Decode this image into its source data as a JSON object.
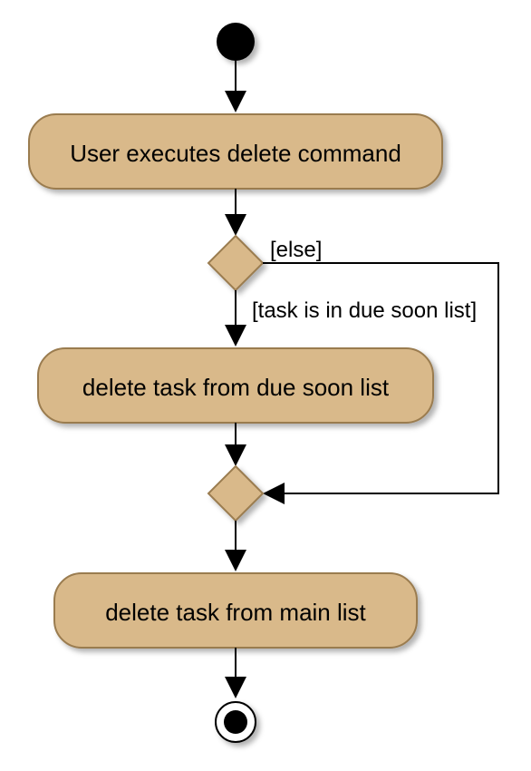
{
  "chart_data": {
    "type": "activity_diagram",
    "title": "",
    "nodes": [
      {
        "id": "start",
        "type": "initial"
      },
      {
        "id": "n1",
        "type": "activity",
        "label": "User executes delete command"
      },
      {
        "id": "d1",
        "type": "decision"
      },
      {
        "id": "n2",
        "type": "activity",
        "label": "delete task from due soon list"
      },
      {
        "id": "m1",
        "type": "merge"
      },
      {
        "id": "n3",
        "type": "activity",
        "label": "delete task from main list"
      },
      {
        "id": "end",
        "type": "final"
      }
    ],
    "edges": [
      {
        "from": "start",
        "to": "n1",
        "guard": ""
      },
      {
        "from": "n1",
        "to": "d1",
        "guard": ""
      },
      {
        "from": "d1",
        "to": "n2",
        "guard": "[task is in due soon list]"
      },
      {
        "from": "d1",
        "to": "m1",
        "guard": "[else]"
      },
      {
        "from": "n2",
        "to": "m1",
        "guard": ""
      },
      {
        "from": "m1",
        "to": "n3",
        "guard": ""
      },
      {
        "from": "n3",
        "to": "end",
        "guard": ""
      }
    ],
    "guard_else": "[else]",
    "guard_duesoon": "[task is in due soon list]"
  },
  "colors": {
    "activity_fill": "#d9b98a",
    "activity_stroke": "#9a7b4f",
    "shadow": "rgba(0,0,0,0.25)",
    "line": "#000"
  }
}
